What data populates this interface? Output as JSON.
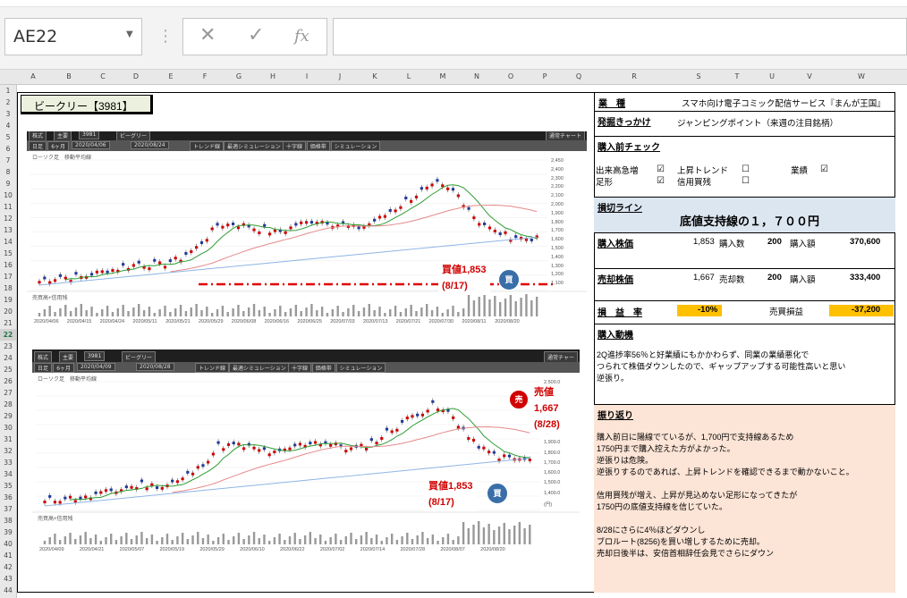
{
  "formula_bar": {
    "name_box": "AE22",
    "cancel_icon": "✕",
    "enter_icon": "✓",
    "fx_icon": "fx",
    "formula": ""
  },
  "columns": [
    "A",
    "B",
    "C",
    "D",
    "E",
    "F",
    "G",
    "H",
    "I",
    "J",
    "K",
    "L",
    "M",
    "N",
    "O",
    "P",
    "Q",
    "R",
    "S",
    "T",
    "U",
    "V",
    "W"
  ],
  "rows": [
    "1",
    "2",
    "3",
    "4",
    "5",
    "6",
    "7",
    "8",
    "9",
    "10",
    "11",
    "12",
    "13",
    "14",
    "15",
    "16",
    "17",
    "18",
    "19",
    "20",
    "21",
    "22",
    "23",
    "24",
    "25",
    "26",
    "27",
    "28",
    "29",
    "30",
    "31",
    "32",
    "33",
    "34",
    "35",
    "36",
    "37",
    "38",
    "39",
    "40",
    "41",
    "42",
    "43",
    "44"
  ],
  "selected_row": "22",
  "sheet": {
    "title": "ビークリー【3981】",
    "industry_label": "業　種",
    "industry_value": "スマホ向け電子コミック配信サービス『まんが王国』",
    "trigger_label": "発掘きっかけ",
    "trigger_value": "ジャンピングポイント（来週の注目銘柄）",
    "check_label": "購入前チェック",
    "checks": [
      {
        "label": "出来高急増",
        "checked": true
      },
      {
        "label": "上昇トレンド",
        "checked": false
      },
      {
        "label": "業績",
        "checked": true
      },
      {
        "label": "足形",
        "checked": true
      },
      {
        "label": "信用買残",
        "checked": false
      }
    ],
    "stop_label": "損切ライン",
    "stop_value": "底値支持線の１，７００円",
    "buy_price_label": "購入株価",
    "buy_price": "1,853",
    "buy_qty_label": "購入数",
    "buy_qty": "200",
    "buy_amount_label": "購入額",
    "buy_amount": "370,600",
    "sell_price_label": "売却株価",
    "sell_price": "1,667",
    "sell_qty_label": "売却数",
    "sell_qty": "200",
    "sell_amount_label": "購入額",
    "sell_amount": "333,400",
    "pl_rate_label": "損　益　率",
    "pl_rate": "-10%",
    "pl_label": "売買損益",
    "pl_value": "-37,200",
    "motive_label": "購入動機",
    "motive_lines": [
      "2Q進捗率56％と好業績にもかかわらず、同業の業績悪化で",
      "つられて株価ダウンしたので、ギャップアップする可能性高いと思い",
      "逆張り。"
    ],
    "review_label": "振り返り",
    "review_lines": [
      "購入前日に陽線でているが、1,700円で支持線あるため",
      "1750円まで購入控えた方がよかった。",
      "逆張りは危険。",
      "逆張りするのであれば、上昇トレンドを確認できるまで動かないこと。",
      "",
      "信用買残が増え、上昇が見込めない足形になってきたが",
      "1750円の底値支持線を信じていた。",
      "",
      "8/28にさらに4％ほどダウンし",
      "ブロルート(8256)を買い増しするために売却。",
      "売却日後半は、安倍首相辞任会見でさらにダウン"
    ]
  },
  "chart1": {
    "tabs": [
      "株式",
      "主要",
      "3981",
      "ビーグリー"
    ],
    "controls": [
      "日足",
      "6ヶ月",
      "2020/04/06",
      "2020/08/24",
      "トレンド線",
      "最適シミュレーション",
      "十字線",
      "価格帯",
      "シミュレーション"
    ],
    "legend": "ローソク足　移動平均線",
    "sub_legend": "売買高+信用残",
    "right_btn": "通常チャート",
    "y_ticks": [
      "2,450",
      "2,400",
      "2,300",
      "2,200",
      "2,100",
      "2,000",
      "1,900",
      "1,800",
      "1,700",
      "1,600",
      "1,500",
      "1,400",
      "1,300",
      "1,200",
      "1,100"
    ],
    "x_ticks": [
      "2020/04/06",
      "2020/04/15",
      "2020/04/24",
      "2020/05/11",
      "2020/05/21",
      "2020/05/29",
      "2020/06/08",
      "2020/06/16",
      "2020/06/25",
      "2020/07/03",
      "2020/07/13",
      "2020/07/21",
      "2020/07/30",
      "2020/08/11",
      "2020/08/20"
    ],
    "buy_label": "買値1,853",
    "buy_date": "(8/17)",
    "buy_icon": "買"
  },
  "chart2": {
    "tabs": [
      "株式",
      "主要",
      "3981",
      "ビーグリー"
    ],
    "controls": [
      "日足",
      "6ヶ月",
      "2020/04/09",
      "2020/08/28",
      "トレンド線",
      "最適シミュレーション",
      "十字線",
      "価格帯",
      "シミュレーション"
    ],
    "legend": "ローソク足　移動平均線",
    "sub_legend": "売買高+信用残",
    "right_btn": "通常チャー",
    "y_ticks": [
      "2,500.0",
      "2,400.0",
      "2,300.0",
      "2,200.0",
      "2,100.0",
      "2,000.0",
      "1,900.0",
      "1,800.0",
      "1,700.0",
      "1,600.0",
      "1,500.0",
      "1,400.0",
      "(円)"
    ],
    "x_ticks": [
      "2020/04/09",
      "2020/04/21",
      "2020/05/07",
      "2020/05/19",
      "2020/05/29",
      "2020/06/10",
      "2020/06/22",
      "2020/07/02",
      "2020/07/14",
      "2020/07/28",
      "2020/08/07",
      "2020/08/20"
    ],
    "buy_label": "買値1,853",
    "buy_date": "(8/17)",
    "buy_icon": "買",
    "sell_label": "売値1,667",
    "sell_date": "(8/28)",
    "sell_icon": "売"
  },
  "colors": {
    "up": "#d00000",
    "down": "#1f3a9b",
    "ma_short": "#2e9d35",
    "ma_mid": "#e58a8a",
    "ma_long": "#8fb5e5",
    "pl_fill": "#ffc000",
    "stop_fill": "#dce6f1",
    "review_fill": "#fce4d6"
  }
}
